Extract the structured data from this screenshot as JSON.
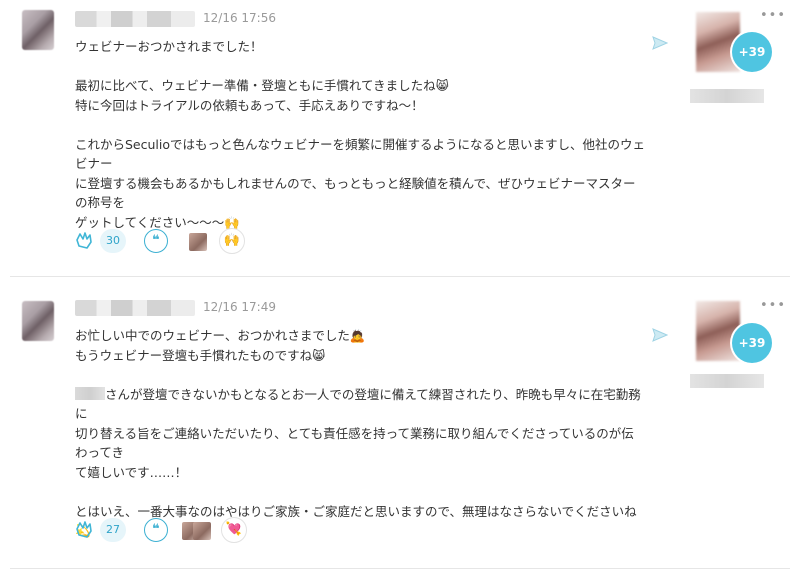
{
  "posts": [
    {
      "timestamp": "12/16 17:56",
      "lines": [
        "ウェビナーおつかされまでした！",
        "",
        "最初に比べて、ウェビナー準備・登壇ともに手慣れてきましたね😸",
        "特に今回はトライアルの依頼もあって、手応えありですね〜！",
        "",
        "これからSeculioではもっと色んなウェビナーを頻繁に開催するようになると思いますし、他社のウェビナー",
        "に登壇する機会もあるかもしれませんので、もっともっと経験値を積んで、ぜひウェビナーマスターの称号を",
        "ゲットしてください〜〜〜🙌"
      ],
      "clap_count": "30",
      "quote_symbol": "❝",
      "reaction_emoji": "🙌",
      "plus_badge": "+39",
      "more_label": "•••"
    },
    {
      "timestamp": "12/16 17:49",
      "lines": [
        "お忙しい中でのウェビナー、おつかれさまでした🙇",
        "もうウェビナー登壇も手慣れたものですね😸",
        "",
        "さんが登壇できないかもとなるとお一人での登壇に備えて練習されたり、昨晩も早々に在宅勤務に",
        "切り替える旨をご連絡いただいたり、とても責任感を持って業務に取り組んでくださっているのが伝わってき",
        "て嬉しいです……！",
        "",
        "とはいえ、一番大事なのはやはりご家族・ご家庭だと思いますので、無理はなさらないでくださいね💫"
      ],
      "clap_count": "27",
      "quote_symbol": "❝",
      "reaction_emoji": "💘",
      "plus_badge": "+39",
      "more_label": "•••"
    }
  ],
  "icons": [
    "clap-icon",
    "quote-icon",
    "send-icon",
    "more-icon"
  ],
  "colors": {
    "accent": "#4fc5e1",
    "text": "#333333",
    "muted": "#9a9a9a"
  }
}
